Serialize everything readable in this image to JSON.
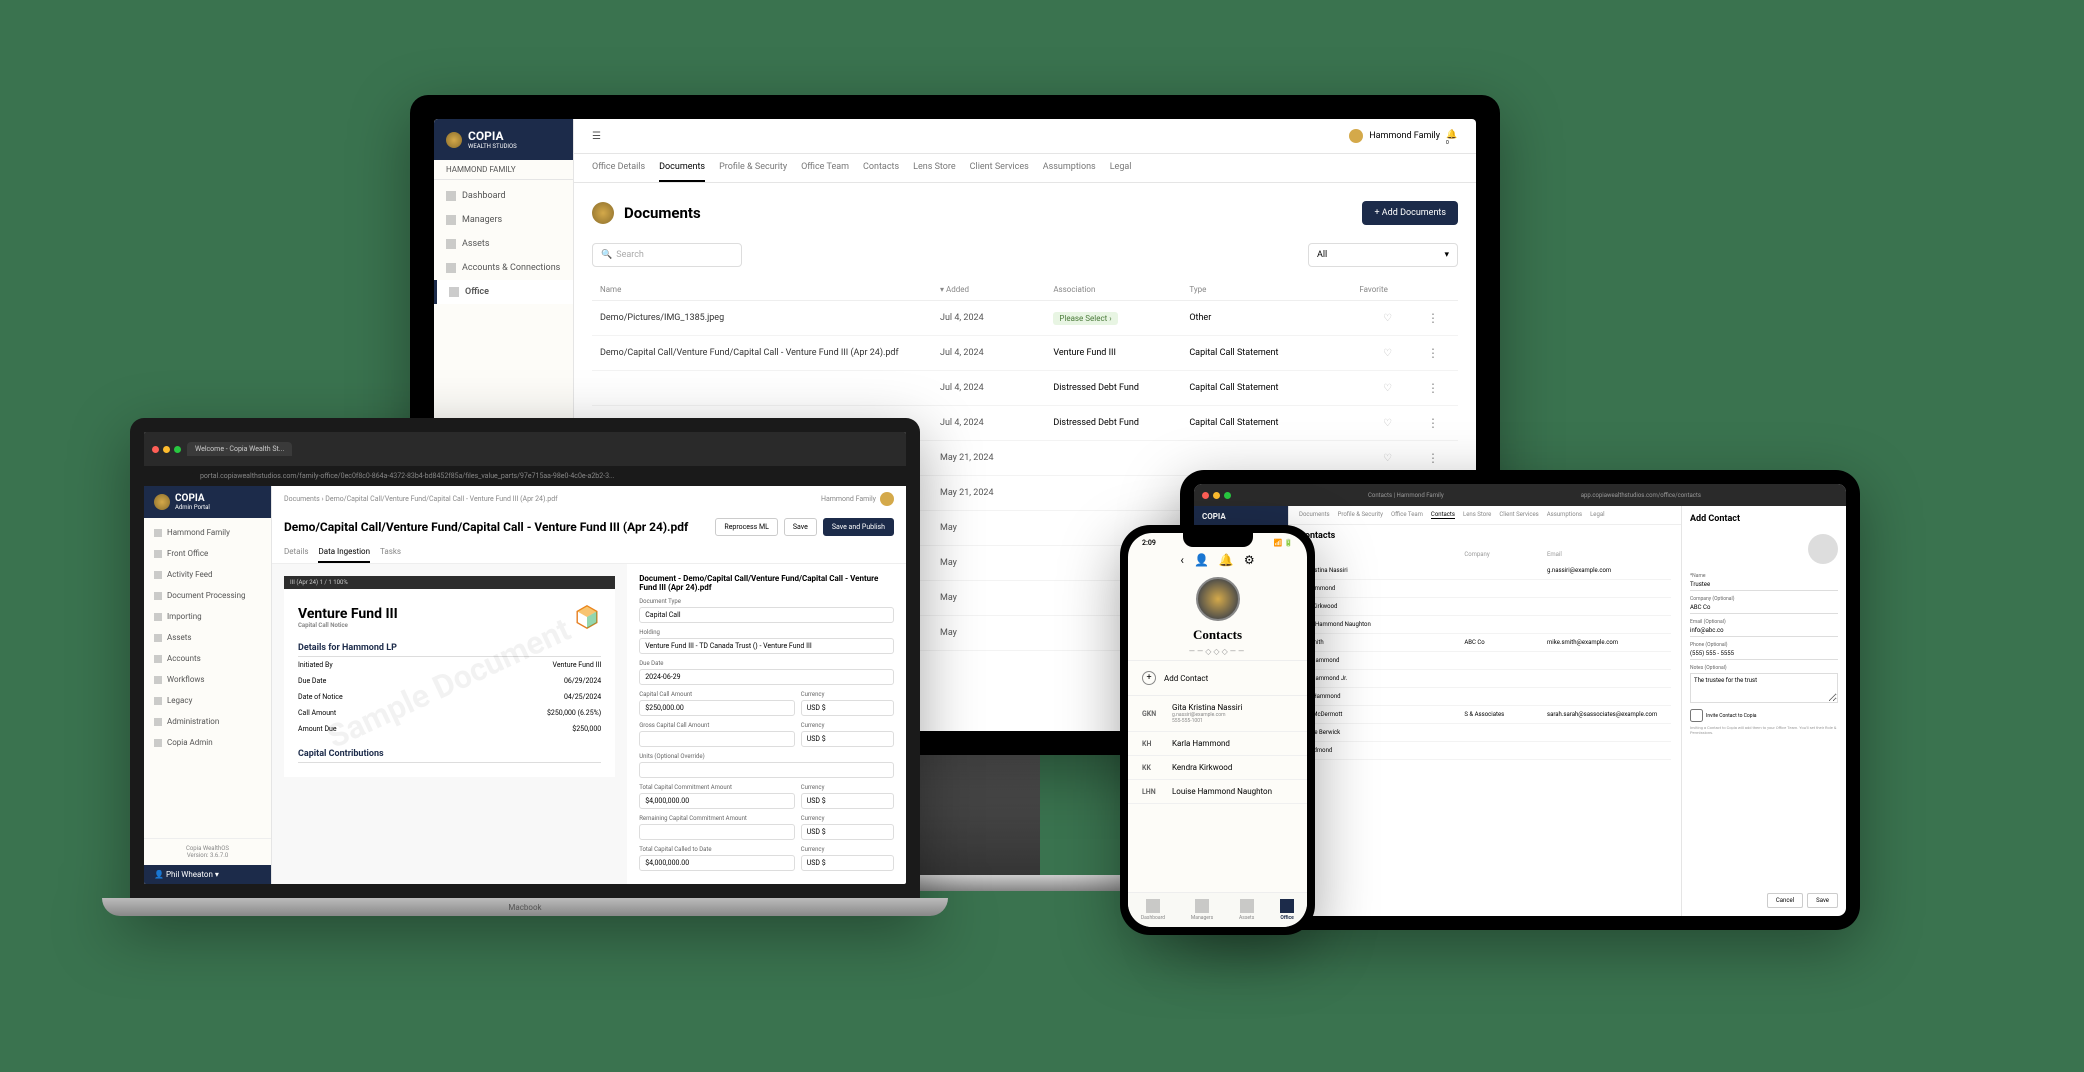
{
  "brand": {
    "name": "COPIA",
    "sub": "WEALTH STUDIOS",
    "admin_sub": "Admin Portal"
  },
  "monitor": {
    "family": "HAMMOND FAMILY",
    "user": "Hammond Family",
    "collapse": "☰",
    "notif_count": "0",
    "nav": [
      {
        "label": "Dashboard"
      },
      {
        "label": "Managers"
      },
      {
        "label": "Assets"
      },
      {
        "label": "Accounts & Connections"
      },
      {
        "label": "Office"
      }
    ],
    "tabs": [
      "Office Details",
      "Documents",
      "Profile & Security",
      "Office Team",
      "Contacts",
      "Lens Store",
      "Client Services",
      "Assumptions",
      "Legal"
    ],
    "active_tab": "Documents",
    "title": "Documents",
    "add_btn": "+  Add Documents",
    "search_ph": "Search",
    "filter": "All",
    "cols": [
      "Name",
      "Added",
      "Association",
      "Type",
      "Favorite"
    ],
    "rows": [
      {
        "name": "Demo/Pictures/IMG_1385.jpeg",
        "added": "Jul 4, 2024",
        "assoc": "Please Select",
        "assoc_badge": true,
        "type": "Other"
      },
      {
        "name": "Demo/Capital Call/Venture Fund/Capital Call - Venture Fund III (Apr 24).pdf",
        "added": "Jul 4, 2024",
        "assoc": "Venture Fund III",
        "type": "Capital Call Statement"
      },
      {
        "name": "",
        "added": "Jul 4, 2024",
        "assoc": "Distressed Debt Fund",
        "type": "Capital Call Statement"
      },
      {
        "name": "",
        "added": "Jul 4, 2024",
        "assoc": "Distressed Debt Fund",
        "type": "Capital Call Statement"
      },
      {
        "name": "",
        "added": "May 21, 2024",
        "assoc": "",
        "type": ""
      },
      {
        "name": "",
        "added": "May 21, 2024",
        "assoc": "",
        "type": ""
      },
      {
        "name": "",
        "added": "May",
        "assoc": "",
        "type": ""
      },
      {
        "name": "",
        "added": "May",
        "assoc": "",
        "type": ""
      },
      {
        "name": "",
        "added": "May",
        "assoc": "",
        "type": ""
      },
      {
        "name": "",
        "added": "May",
        "assoc": "",
        "type": ""
      }
    ]
  },
  "laptop": {
    "browser_tab": "Welcome - Copia Wealth St...",
    "url": "portal.copiawealthstudios.com/family-office/0ec0f8c0-864a-4372-83b4-bd8452f85a/files_value_parts/97e715aa-98e0-4c0e-a2b2-3...",
    "user": "Hammond Family",
    "nav": [
      "Hammond Family",
      "Front Office",
      "Activity Feed",
      "Document Processing",
      "Importing",
      "Assets",
      "Accounts",
      "Workflows",
      "Legacy",
      "Administration",
      "Copia Admin"
    ],
    "version_label": "Copia WealthOS",
    "version": "Version: 3.6.7.0",
    "userbar": "Phil Wheaton ▾",
    "crumbs": "Documents  ›  Demo/Capital Call/Venture Fund/Capital Call - Venture Fund III (Apr 24).pdf",
    "doc_title": "Demo/Capital Call/Venture Fund/Capital Call - Venture Fund III (Apr 24).pdf",
    "btns": {
      "reprocess": "Reprocess ML",
      "save": "Save",
      "publish": "Save and Publish"
    },
    "subtabs": [
      "Details",
      "Data Ingestion",
      "Tasks"
    ],
    "subtab_active": "Data Ingestion",
    "pdf": {
      "bar": "III (Apr 24)    1 / 1    100%",
      "fund": "Venture Fund III",
      "notice": "Capital Call Notice",
      "section1": "Details for Hammond LP",
      "rows1": [
        {
          "k": "Initiated By",
          "v": "Venture Fund III"
        },
        {
          "k": "Due Date",
          "v": "06/29/2024"
        },
        {
          "k": "Date of Notice",
          "v": "04/25/2024"
        },
        {
          "k": "Call Amount",
          "v": "$250,000 (6.25%)"
        },
        {
          "k": "Amount Due",
          "v": "$250,000"
        }
      ],
      "section2": "Capital Contributions",
      "watermark": "Sample Document"
    },
    "form": {
      "title": "Document - Demo/Capital Call/Venture Fund/Capital Call - Venture Fund III (Apr 24).pdf",
      "labels": {
        "doc_type": "Document Type",
        "holding": "Holding",
        "due": "Due Date",
        "cap_amt": "Capital Call Amount",
        "currency": "Currency",
        "gross": "Gross Capital Call Amount",
        "units": "Units (Optional Override)",
        "total_commit": "Total Capital Commitment Amount",
        "remaining": "Remaining Capital Commitment Amount",
        "called_date": "Total Capital Called to Date"
      },
      "values": {
        "doc_type": "Capital Call",
        "holding": "Venture Fund III - TD Canada Trust () - Venture Fund III",
        "due": "2024-06-29",
        "cap_amt": "$250,000.00",
        "cap_cur": "USD $",
        "gross": "",
        "gross_cur": "USD $",
        "units": "",
        "total_commit": "$4,000,000.00",
        "total_cur": "USD $",
        "remaining": "",
        "remain_cur": "USD $",
        "called_date": "$4,000,000.00",
        "called_cur": "USD $"
      }
    }
  },
  "phone": {
    "time": "2:09",
    "title": "Contacts",
    "add": "Add Contact",
    "contacts": [
      {
        "in": "GKN",
        "name": "Gita Kristina Nassiri",
        "email": "g.nassiri@example.com",
        "phone": "555-555-1001"
      },
      {
        "in": "KH",
        "name": "Karla Hammond"
      },
      {
        "in": "KK",
        "name": "Kendra Kirkwood"
      },
      {
        "in": "LHN",
        "name": "Louise Hammond Naughton"
      }
    ],
    "tabs": [
      "Dashboard",
      "Managers",
      "Assets",
      "Office"
    ],
    "tab_active": "Office"
  },
  "tablet": {
    "url": "app.copiawealthstudios.com/office/contacts",
    "browser_tab": "Contacts | Hammond Family",
    "tabs": [
      "Documents",
      "Profile & Security",
      "Office Team",
      "Contacts",
      "Lens Store",
      "Client Services",
      "Assumptions",
      "Legal"
    ],
    "tab_active": "Contacts",
    "title": "Contacts",
    "cols": [
      "",
      "Company",
      "Email"
    ],
    "rows": [
      {
        "name": "ita Kristina Nassiri",
        "company": "",
        "email": "g.nassiri@example.com"
      },
      {
        "name": "ris Hammond",
        "company": "",
        "email": ""
      },
      {
        "name": "ndra Kirkwood",
        "company": "",
        "email": ""
      },
      {
        "name": "ouise Hammond Naughton",
        "company": "",
        "email": ""
      },
      {
        "name": "ike Smith",
        "company": "ABC Co",
        "email": "mike.smith@example.com"
      },
      {
        "name": "bert Hammond",
        "company": "",
        "email": ""
      },
      {
        "name": "bert Hammond Jr.",
        "company": "",
        "email": ""
      },
      {
        "name": "ndra Hammond",
        "company": "",
        "email": ""
      },
      {
        "name": "arah McDermott",
        "company": "S & Associates",
        "email": "sarah.sarah@sassociates@example.com"
      },
      {
        "name": "eodore Berwick",
        "company": "",
        "email": ""
      },
      {
        "name": "ny Redmond",
        "company": "",
        "email": ""
      }
    ],
    "panel": {
      "title": "Add Contact",
      "labels": {
        "name": "*Name",
        "company": "Company (Optional)",
        "email": "Email (Optional)",
        "phone": "Phone (Optional)",
        "notes": "Notes (Optional)"
      },
      "values": {
        "name": "Trustee",
        "company": "ABC Co",
        "email": "info@abc.co",
        "phone": "(555) 555 - 5555",
        "notes": "The trustee for the trust"
      },
      "invite": "Invite Contact to Copia",
      "hint": "Inviting a Contact to Copia will add them to your Office Team. You'll set their Role & Permissions.",
      "cancel": "Cancel",
      "save": "Save"
    }
  }
}
